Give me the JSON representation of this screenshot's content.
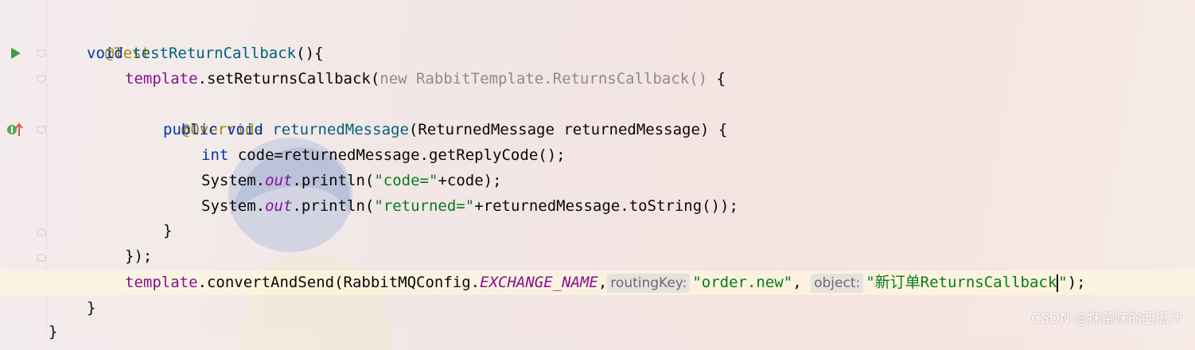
{
  "editor": {
    "lines": {
      "l1": {
        "annotation": "@Test"
      },
      "l2": {
        "kw": "void",
        "name": "testReturnCallback",
        "rest": "(){"
      },
      "l3": {
        "field": "template",
        "call": ".setReturnsCallback(",
        "gray": "new RabbitTemplate.ReturnsCallback()",
        "rest": " {"
      },
      "l4": {
        "annotation": "@Override"
      },
      "l5": {
        "kw": "public void",
        "name": "returnedMessage",
        "rest": "(ReturnedMessage returnedMessage) {"
      },
      "l6": {
        "kw": "int",
        "rest": " code=returnedMessage.getReplyCode();"
      },
      "l7": {
        "pre": "System.",
        "field": "out",
        "call": ".println(",
        "str": "\"code=\"",
        "rest": "+code);"
      },
      "l8": {
        "pre": "System.",
        "field": "out",
        "call": ".println(",
        "str": "\"returned=\"",
        "rest": "+returnedMessage.toString());"
      },
      "l9": {
        "text": "}"
      },
      "l10": {
        "text": "});"
      },
      "l11": {
        "field": "template",
        "call": ".convertAndSend(RabbitMQConfig.",
        "constant": "EXCHANGE_NAME",
        "comma": ",",
        "hint1": "routingKey:",
        "str1": "\"order.new\"",
        "comma2": ",",
        "hint2": "object:",
        "str2a": "\"新订单ReturnsCallback",
        "str2b": "\"",
        "rest": ");"
      },
      "l12": {
        "text": "}"
      },
      "l13": {
        "text": "}"
      }
    },
    "gutter": {
      "run_icon": "run-test-icon",
      "impl_icon": "implements-method-icon"
    },
    "watermark": "CSDN @抹茶味的西瓜汁"
  }
}
